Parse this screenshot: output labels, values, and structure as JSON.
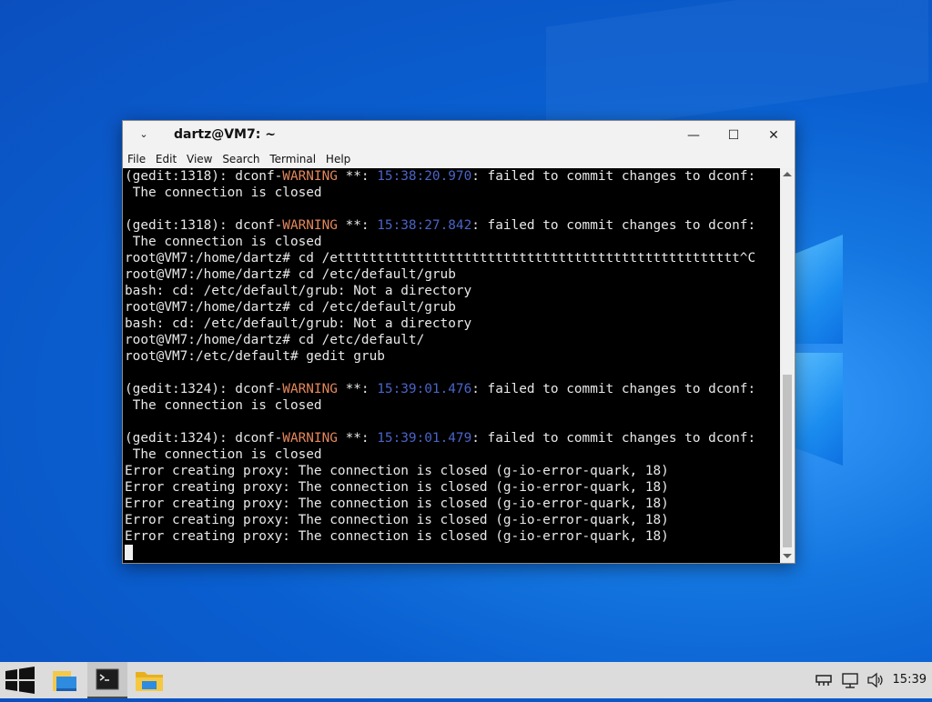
{
  "window": {
    "title": "dartz@VM7: ~",
    "menu": [
      "File",
      "Edit",
      "View",
      "Search",
      "Terminal",
      "Help"
    ]
  },
  "terminal_lines": [
    [
      {
        "t": "(gedit:1318): dconf-"
      },
      {
        "t": "WARNING",
        "c": "warn"
      },
      {
        "t": " **: "
      },
      {
        "t": "15:38:20.970",
        "c": "ts"
      },
      {
        "t": ": failed to commit changes to dconf:"
      }
    ],
    [
      {
        "t": " The connection is closed"
      }
    ],
    [
      {
        "t": ""
      }
    ],
    [
      {
        "t": "(gedit:1318): dconf-"
      },
      {
        "t": "WARNING",
        "c": "warn"
      },
      {
        "t": " **: "
      },
      {
        "t": "15:38:27.842",
        "c": "ts"
      },
      {
        "t": ": failed to commit changes to dconf:"
      }
    ],
    [
      {
        "t": " The connection is closed"
      }
    ],
    [
      {
        "t": "root@VM7:/home/dartz# cd /ettttttttttttttttttttttttttttttttttttttttttttttttttt^C"
      }
    ],
    [
      {
        "t": "root@VM7:/home/dartz# cd /etc/default/grub"
      }
    ],
    [
      {
        "t": "bash: cd: /etc/default/grub: Not a directory"
      }
    ],
    [
      {
        "t": "root@VM7:/home/dartz# cd /etc/default/grub"
      }
    ],
    [
      {
        "t": "bash: cd: /etc/default/grub: Not a directory"
      }
    ],
    [
      {
        "t": "root@VM7:/home/dartz# cd /etc/default/"
      }
    ],
    [
      {
        "t": "root@VM7:/etc/default# gedit grub"
      }
    ],
    [
      {
        "t": ""
      }
    ],
    [
      {
        "t": "(gedit:1324): dconf-"
      },
      {
        "t": "WARNING",
        "c": "warn"
      },
      {
        "t": " **: "
      },
      {
        "t": "15:39:01.476",
        "c": "ts"
      },
      {
        "t": ": failed to commit changes to dconf:"
      }
    ],
    [
      {
        "t": " The connection is closed"
      }
    ],
    [
      {
        "t": ""
      }
    ],
    [
      {
        "t": "(gedit:1324): dconf-"
      },
      {
        "t": "WARNING",
        "c": "warn"
      },
      {
        "t": " **: "
      },
      {
        "t": "15:39:01.479",
        "c": "ts"
      },
      {
        "t": ": failed to commit changes to dconf:"
      }
    ],
    [
      {
        "t": " The connection is closed"
      }
    ],
    [
      {
        "t": "Error creating proxy: The connection is closed (g-io-error-quark, 18)"
      }
    ],
    [
      {
        "t": "Error creating proxy: The connection is closed (g-io-error-quark, 18)"
      }
    ],
    [
      {
        "t": "Error creating proxy: The connection is closed (g-io-error-quark, 18)"
      }
    ],
    [
      {
        "t": "Error creating proxy: The connection is closed (g-io-error-quark, 18)"
      }
    ],
    [
      {
        "t": "Error creating proxy: The connection is closed (g-io-error-quark, 18)"
      }
    ]
  ],
  "taskbar": {
    "clock": "15:39",
    "items": [
      "start-button",
      "file-manager",
      "terminal",
      "folder"
    ]
  },
  "colors": {
    "warning": "#e5875b",
    "timestamp": "#4a64c8",
    "terminal_bg": "#000000"
  }
}
